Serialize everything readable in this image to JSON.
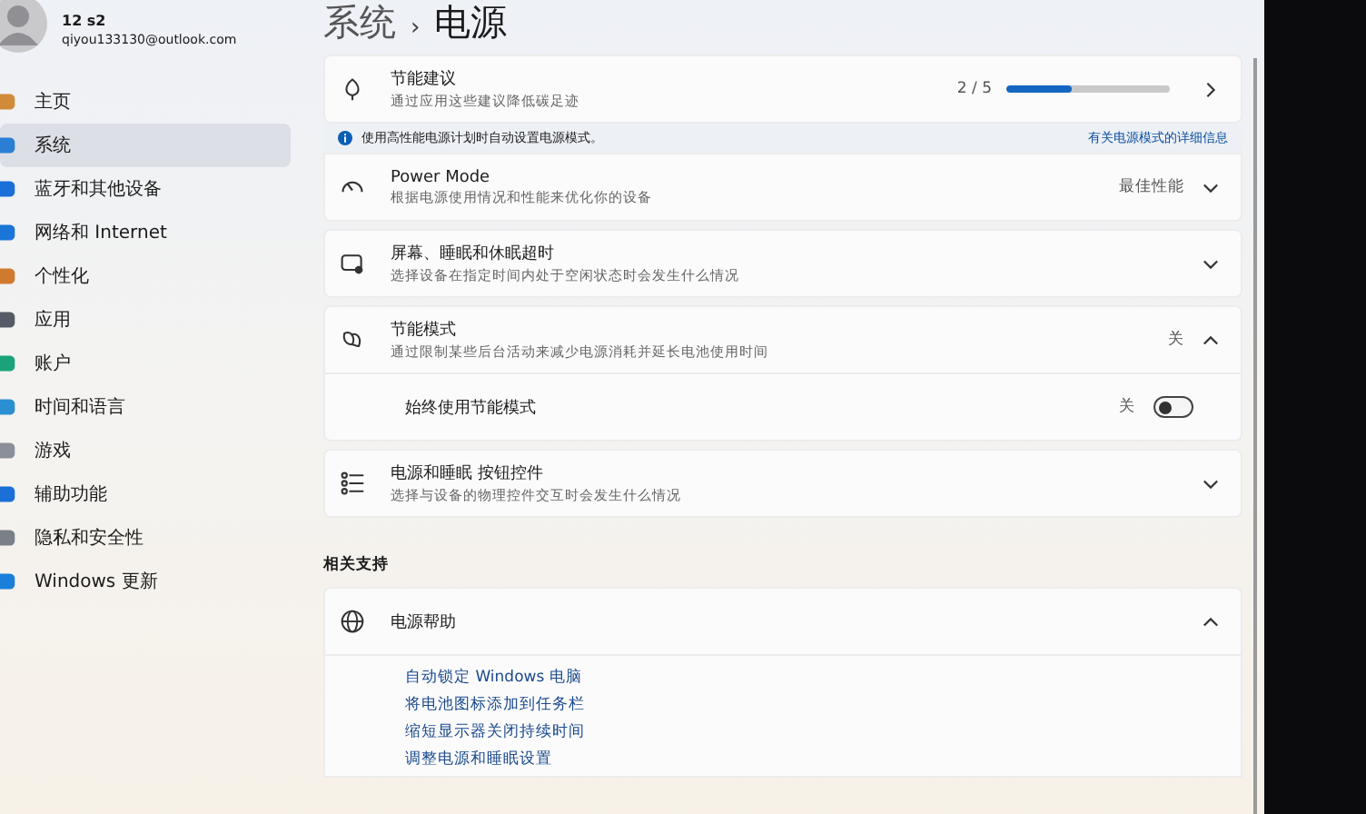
{
  "account": {
    "name": "12 s2",
    "email": "qiyou133130@outlook.com"
  },
  "sidebar": {
    "items": [
      {
        "label": "主页",
        "selected": false
      },
      {
        "label": "系统",
        "selected": true
      },
      {
        "label": "蓝牙和其他设备",
        "selected": false
      },
      {
        "label": "网络和 Internet",
        "selected": false
      },
      {
        "label": "个性化",
        "selected": false
      },
      {
        "label": "应用",
        "selected": false
      },
      {
        "label": "账户",
        "selected": false
      },
      {
        "label": "时间和语言",
        "selected": false
      },
      {
        "label": "游戏",
        "selected": false
      },
      {
        "label": "辅助功能",
        "selected": false
      },
      {
        "label": "隐私和安全性",
        "selected": false
      },
      {
        "label": "Windows 更新",
        "selected": false
      }
    ]
  },
  "breadcrumb": {
    "parent": "系统",
    "separator": "›",
    "current": "电源"
  },
  "energy_card": {
    "title": "节能建议",
    "subtitle": "通过应用这些建议降低碳足迹",
    "count": "2 / 5",
    "level": 0.4
  },
  "info_bar": {
    "text": "使用高性能电源计划时自动设置电源模式。",
    "link": "有关电源模式的详细信息"
  },
  "settings": [
    {
      "title": "Power Mode",
      "subtitle": "根据电源使用情况和性能来优化你的设备",
      "value": "最佳性能",
      "expanded": false
    },
    {
      "title": "屏幕、睡眠和休眠超时",
      "subtitle": "选择设备在指定时间内处于空闲状态时会发生什么情况",
      "expanded": false
    },
    {
      "title": "节能模式",
      "subtitle": "通过限制某些后台活动来减少电源消耗并延长电池使用时间",
      "value": "关",
      "expanded": true,
      "child": {
        "label": "始终使用节能模式",
        "state_text": "关",
        "on": false
      }
    },
    {
      "title": "电源和睡眠 按钮控件",
      "subtitle": "选择与设备的物理控件交互时会发生什么情况",
      "expanded": false
    }
  ],
  "related": {
    "heading": "相关支持",
    "card": {
      "title": "电源帮助",
      "expanded": true,
      "links": [
        "自动锁定 Windows 电脑",
        "将电池图标添加到任务栏",
        "缩短显示器关闭持续时间",
        "调整电源和睡眠设置"
      ]
    }
  }
}
